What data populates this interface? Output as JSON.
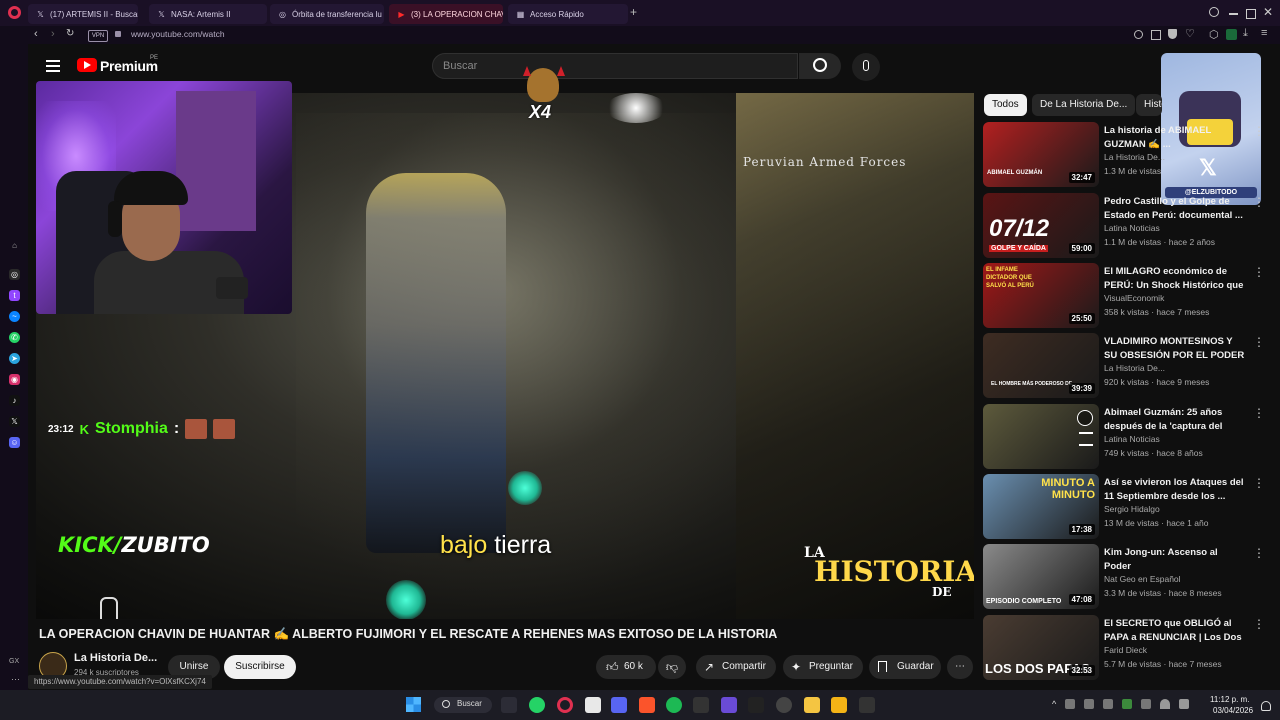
{
  "browser": {
    "tabs": [
      {
        "label": "(17) ARTEMIS II - Buscar /",
        "icon": "x-icon"
      },
      {
        "label": "NASA: Artemis II",
        "icon": "x-icon"
      },
      {
        "label": "Órbita de transferencia lu",
        "icon": "globe-icon"
      },
      {
        "label": "(3) LA OPERACION CHAVI",
        "icon": "youtube-icon",
        "active": true
      },
      {
        "label": "Acceso Rápido",
        "icon": "grid-icon"
      }
    ],
    "vpn": "VPN",
    "url": "www.youtube.com/watch",
    "status_url": "https://www.youtube.com/watch?v=OlXsfKCXj74",
    "side_bottom": "GX"
  },
  "yt": {
    "logo": "Premium",
    "logo_sup": "PE",
    "search_placeholder": "Buscar"
  },
  "video": {
    "overlay_watermark": "Peruvian Armed Forces",
    "subtitle_a": "bajo",
    "subtitle_b": "tierra",
    "badge": "X4",
    "chat_time": "23:12",
    "chat_user": "Stomphia",
    "chat_sep": ":",
    "kick_a": "KICK/",
    "kick_b": "ZUBITO",
    "brand_1": "LA",
    "brand_2": "HISTORIA",
    "brand_3": "DE",
    "corner_handle": "@ELZUBITODO",
    "title": "LA OPERACION CHAVIN DE HUANTAR ✍️ ALBERTO FUJIMORI Y EL RESCATE A REHENES MAS EXITOSO DE LA HISTORIA"
  },
  "channel": {
    "name": "La Historia De...",
    "subs": "294 k suscriptores",
    "join": "Unirse",
    "subscribe": "Suscribirse"
  },
  "actions": {
    "likes": "60 k",
    "share": "Compartir",
    "ask": "Preguntar",
    "save": "Guardar"
  },
  "chips": [
    "Todos",
    "De La Historia De...",
    "Histo"
  ],
  "recs": [
    {
      "title": "La historia de ABIMAEL GUZMAN ✍️ ...",
      "channel": "La Historia De...",
      "meta": "1.3 M de vistas",
      "dur": "32:47",
      "thumb": "#b32020"
    },
    {
      "title": "Pedro Castillo y el Golpe de Estado en Perú: documental ...",
      "channel": "Latina Noticias",
      "meta": "1.1 M de vistas · hace 2 años",
      "dur": "59:00",
      "thumb": "#5a1414"
    },
    {
      "title": "El MILAGRO económico de PERÚ: Un Shock Histórico que ...",
      "channel": "VisualEconomik",
      "meta": "358 k vistas · hace 7 meses",
      "dur": "25:50",
      "thumb": "#a01818"
    },
    {
      "title": "VLADIMIRO MONTESINOS Y SU OBSESIÓN POR EL PODER ✍️ ...",
      "channel": "La Historia De...",
      "meta": "920 k vistas · hace 9 meses",
      "dur": "39:39",
      "thumb": "#3e2c22"
    },
    {
      "title": "Abimael Guzmán: 25 años después de la 'captura del sigl...",
      "channel": "Latina Noticias",
      "meta": "749 k vistas · hace 8 años",
      "dur": "",
      "thumb": "#5d5a3c"
    },
    {
      "title": "Así se vivieron los Ataques del 11 Septiembre desde los ...",
      "channel": "Sergio Hidalgo",
      "meta": "13 M de vistas · hace 1 año",
      "dur": "17:38",
      "thumb": "#6a8fb0"
    },
    {
      "title": "Kim Jong-un: Ascenso al Poder",
      "channel": "Nat Geo en Español",
      "meta": "3.3 M de vistas · hace 8 meses",
      "dur": "47:08",
      "thumb": "#8a8a8a"
    },
    {
      "title": "El SECRETO que OBLIGÓ al PAPA a RENUNCIAR | Los Dos ...",
      "channel": "Farid Dieck",
      "meta": "5.7 M de vistas · hace 7 meses",
      "dur": "32:53",
      "thumb": "#4a3c32"
    }
  ],
  "thumb_texts": {
    "t1": "ABIMAEL GUZMÁN",
    "t2": "07/12",
    "t2b": "GOLPE Y CAÍDA",
    "t3": "EL INFAME DICTADOR QUE SALVÓ AL PERÚ",
    "t4": "EL HOMBRE MÁS PODEROSO DE...",
    "t6": "MINUTO A MINUTO",
    "t7": "EPISODIO COMPLETO",
    "t8": "LOS DOS PAPAS"
  },
  "taskbar": {
    "search": "Buscar",
    "time": "11:12 p. m.",
    "date": "03/04/2026"
  }
}
